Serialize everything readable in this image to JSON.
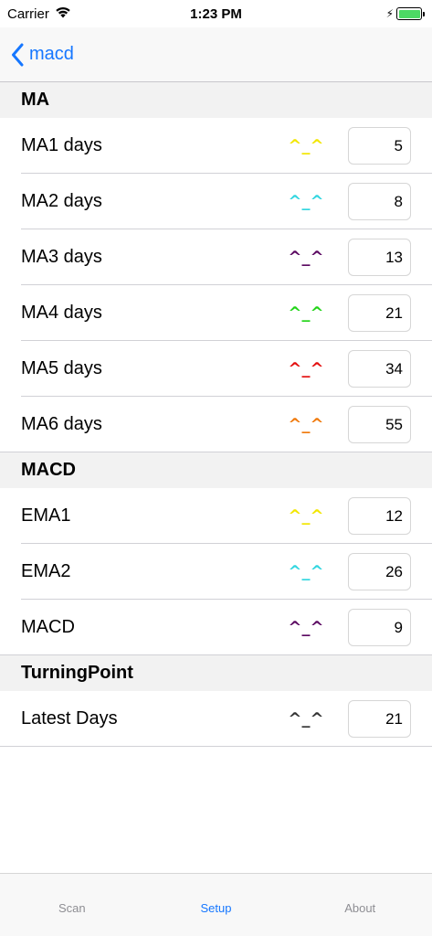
{
  "status_bar": {
    "carrier": "Carrier",
    "time": "1:23 PM",
    "battery_color": "#4cd964"
  },
  "nav": {
    "back_label": "macd",
    "back_icon": "chevron-left-icon",
    "accent_color": "#1677ff"
  },
  "sections": [
    {
      "title": "MA",
      "rows": [
        {
          "label": "MA1 days",
          "face": "^_^",
          "face_color": "#f2e600",
          "value": "5"
        },
        {
          "label": "MA2 days",
          "face": "^_^",
          "face_color": "#33d6e0",
          "value": "8"
        },
        {
          "label": "MA3 days",
          "face": "^_^",
          "face_color": "#5c0a62",
          "value": "13"
        },
        {
          "label": "MA4 days",
          "face": "^_^",
          "face_color": "#22d418",
          "value": "21"
        },
        {
          "label": "MA5 days",
          "face": "^_^",
          "face_color": "#e30e0e",
          "value": "34"
        },
        {
          "label": "MA6 days",
          "face": "^_^",
          "face_color": "#f07a0c",
          "value": "55"
        }
      ]
    },
    {
      "title": "MACD",
      "rows": [
        {
          "label": "EMA1",
          "face": "^_^",
          "face_color": "#f2e600",
          "value": "12"
        },
        {
          "label": "EMA2",
          "face": "^_^",
          "face_color": "#33d6e0",
          "value": "26"
        },
        {
          "label": "MACD",
          "face": "^_^",
          "face_color": "#5c0a62",
          "value": "9"
        }
      ]
    },
    {
      "title": "TurningPoint",
      "rows": [
        {
          "label": "Latest Days",
          "face": "^_^",
          "face_color": "#333333",
          "value": "21"
        }
      ]
    }
  ],
  "tabs": [
    {
      "label": "Scan",
      "active": false
    },
    {
      "label": "Setup",
      "active": true
    },
    {
      "label": "About",
      "active": false
    }
  ]
}
